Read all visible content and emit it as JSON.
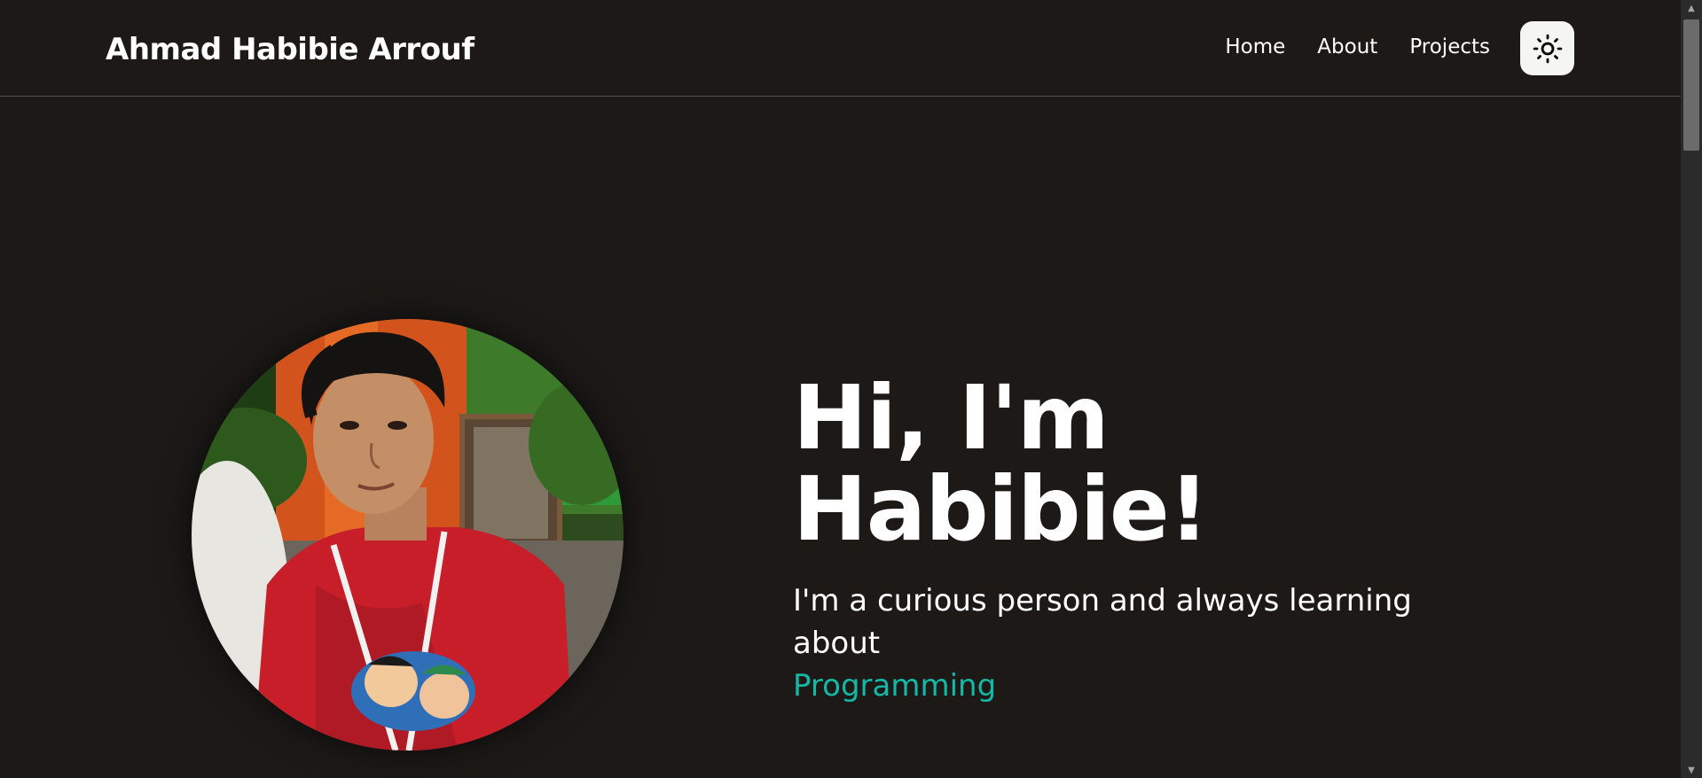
{
  "header": {
    "brand": "Ahmad Habibie Arrouf",
    "nav": [
      {
        "label": "Home"
      },
      {
        "label": "About"
      },
      {
        "label": "Projects"
      }
    ],
    "theme_toggle_icon": "sun-icon"
  },
  "hero": {
    "title_line1": "Hi, I'm",
    "title_line2": "Habibie!",
    "subtitle": "I'm a curious person and always learning about",
    "accent_word": "Programming",
    "accent_color": "#14b8a6",
    "avatar_icon": "profile-photo"
  },
  "colors": {
    "background": "#1c1917",
    "text": "#ffffff",
    "toggle_bg": "#f5f5f4"
  }
}
